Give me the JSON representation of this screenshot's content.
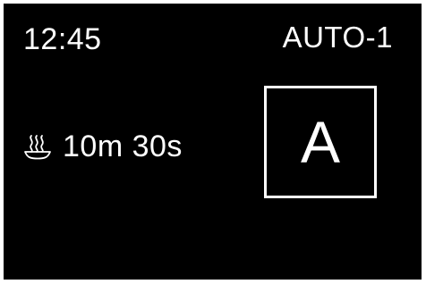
{
  "display": {
    "clock": "12:45",
    "program": "AUTO-1",
    "timer": {
      "icon": "steam-bowl-icon",
      "value": "10m 30s"
    },
    "mode_badge": "A"
  },
  "colors": {
    "screen_background": "#000000",
    "foreground": "#ffffff"
  }
}
